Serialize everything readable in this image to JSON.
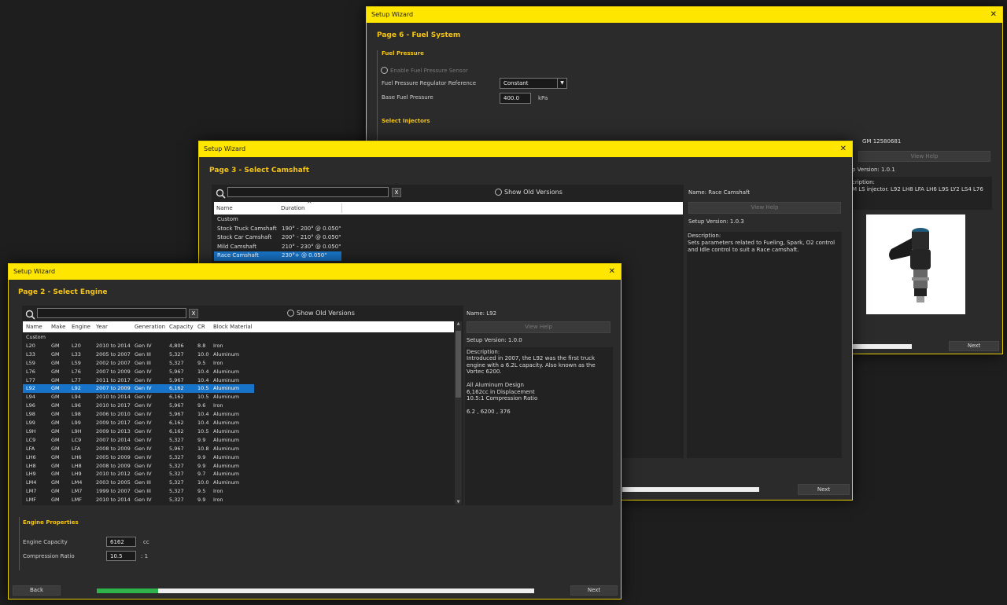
{
  "win6": {
    "title": "Setup Wizard",
    "close": "✕",
    "page_title": "Page 6 - Fuel System",
    "fuel_pressure_section": "Fuel Pressure",
    "enable_sensor": "Enable Fuel Pressure Sensor",
    "regulator_label": "Fuel Pressure Regulator Reference",
    "regulator_value": "Constant",
    "base_pressure_label": "Base Fuel Pressure",
    "base_pressure_value": "400.0",
    "base_pressure_unit": "kPa",
    "injectors_section": "Select Injectors",
    "name": "GM 12580681",
    "view_help": "View Help",
    "setup_version": "p Version: 1.0.1",
    "desc_label": "cription:",
    "desc_text": "M LS injector. L92 LH8 LFA LH6 L9S LY2 LS4 L76",
    "next": "Next",
    "progress": 0.82
  },
  "win3": {
    "title": "Setup Wizard",
    "close": "✕",
    "page_title": "Page 3 - Select Camshaft",
    "show_old_versions": "Show Old Versions",
    "x": "X",
    "columns": [
      "Name",
      "Duration"
    ],
    "rows": [
      [
        "Custom",
        ""
      ],
      [
        "Stock Truck Camshaft",
        "190° - 200° @ 0.050\""
      ],
      [
        "Stock Car Camshaft",
        "200° - 210° @ 0.050\""
      ],
      [
        "Mild Camshaft",
        "210° - 230° @ 0.050\""
      ],
      [
        "Race Camshaft",
        "230°+ @ 0.050\""
      ]
    ],
    "selected_index": 4,
    "name_label": "Name:",
    "name_value": "Race Camshaft",
    "view_help": "View Help",
    "setup_version": "Setup Version: 1.0.3",
    "desc_label": "Description:",
    "desc_text": "Sets parameters related to Fueling, Spark, O2 control and Idle control to suit a Race camshaft.",
    "next": "Next",
    "progress": 0.73
  },
  "win2": {
    "title": "Setup Wizard",
    "close": "✕",
    "page_title": "Page 2 - Select Engine",
    "show_old_versions": "Show Old Versions",
    "x": "X",
    "columns": [
      "Name",
      "Make",
      "Engine",
      "Year",
      "Generation",
      "Capacity",
      "CR",
      "Block Material"
    ],
    "custom_row": "Custom",
    "rows": [
      [
        "L20",
        "GM",
        "L20",
        "2010 to 2014",
        "Gen IV",
        "4,806",
        "8.8",
        "Iron"
      ],
      [
        "L33",
        "GM",
        "L33",
        "2005 to 2007",
        "Gen III",
        "5,327",
        "10.0",
        "Aluminum"
      ],
      [
        "L59",
        "GM",
        "L59",
        "2002 to 2007",
        "Gen III",
        "5,327",
        "9.5",
        "Iron"
      ],
      [
        "L76",
        "GM",
        "L76",
        "2007 to 2009",
        "Gen IV",
        "5,967",
        "10.4",
        "Aluminum"
      ],
      [
        "L77",
        "GM",
        "L77",
        "2011 to 2017",
        "Gen IV",
        "5,967",
        "10.4",
        "Aluminum"
      ],
      [
        "L92",
        "GM",
        "L92",
        "2007 to 2009",
        "Gen IV",
        "6,162",
        "10.5",
        "Aluminum"
      ],
      [
        "L94",
        "GM",
        "L94",
        "2010 to 2014",
        "Gen IV",
        "6,162",
        "10.5",
        "Aluminum"
      ],
      [
        "L96",
        "GM",
        "L96",
        "2010 to 2017",
        "Gen IV",
        "5,967",
        "9.6",
        "Iron"
      ],
      [
        "L98",
        "GM",
        "L98",
        "2006 to 2010",
        "Gen IV",
        "5,967",
        "10.4",
        "Aluminum"
      ],
      [
        "L99",
        "GM",
        "L99",
        "2009 to 2017",
        "Gen IV",
        "6,162",
        "10.4",
        "Aluminum"
      ],
      [
        "L9H",
        "GM",
        "L9H",
        "2009 to 2013",
        "Gen IV",
        "6,162",
        "10.5",
        "Aluminum"
      ],
      [
        "LC9",
        "GM",
        "LC9",
        "2007 to 2014",
        "Gen IV",
        "5,327",
        "9.9",
        "Aluminum"
      ],
      [
        "LFA",
        "GM",
        "LFA",
        "2008 to 2009",
        "Gen IV",
        "5,967",
        "10.8",
        "Aluminum"
      ],
      [
        "LH6",
        "GM",
        "LH6",
        "2005 to 2009",
        "Gen IV",
        "5,327",
        "9.9",
        "Aluminum"
      ],
      [
        "LH8",
        "GM",
        "LH8",
        "2008 to 2009",
        "Gen IV",
        "5,327",
        "9.9",
        "Aluminum"
      ],
      [
        "LH9",
        "GM",
        "LH9",
        "2010 to 2012",
        "Gen IV",
        "5,327",
        "9.7",
        "Aluminum"
      ],
      [
        "LM4",
        "GM",
        "LM4",
        "2003 to 2005",
        "Gen III",
        "5,327",
        "10.0",
        "Aluminum"
      ],
      [
        "LM7",
        "GM",
        "LM7",
        "1999 to 2007",
        "Gen III",
        "5,327",
        "9.5",
        "Iron"
      ],
      [
        "LMF",
        "GM",
        "LMF",
        "2010 to 2014",
        "Gen IV",
        "5,327",
        "9.9",
        "Iron"
      ]
    ],
    "selected_index": 5,
    "name_label": "Name:",
    "name_value": "L92",
    "view_help": "View Help",
    "setup_version": "Setup Version: 1.0.0",
    "desc_label": "Description:",
    "desc_text": "Introduced in 2007, the L92 was the first truck engine with a 6.2L capacity. Also known as the Vortec 6200.\n\nAll Aluminum Design\n6,162cc in Displacement\n10.5:1 Compression Ratio\n\n6.2 , 6200 , 376",
    "props_section": "Engine Properties",
    "capacity_label": "Engine Capacity",
    "capacity_value": "6162",
    "capacity_unit": "cc",
    "cr_label": "Compression Ratio",
    "cr_value": "10.5",
    "cr_unit": ": 1",
    "back": "Back",
    "next": "Next",
    "progress": 0.14
  }
}
